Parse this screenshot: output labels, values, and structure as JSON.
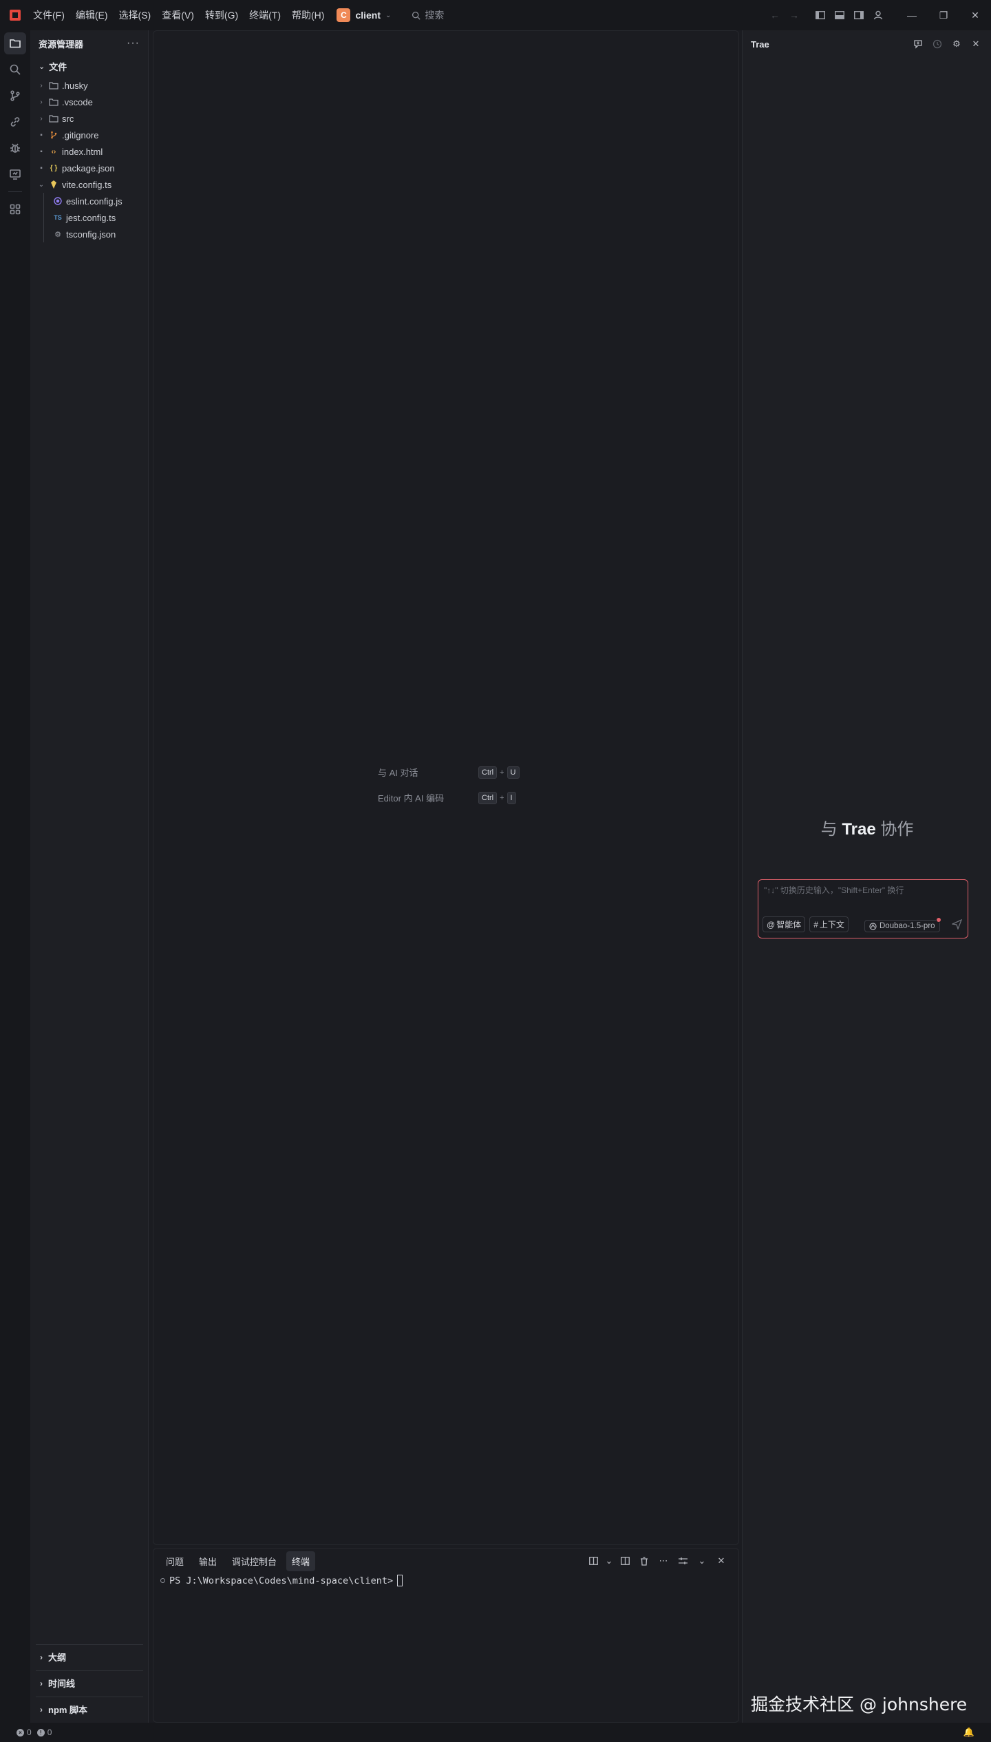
{
  "titlebar": {
    "menus": [
      "文件(F)",
      "编辑(E)",
      "选择(S)",
      "查看(V)",
      "转到(G)",
      "终端(T)",
      "帮助(H)"
    ],
    "project_badge": "C",
    "project_name": "client",
    "search_placeholder": "搜索"
  },
  "sidebar": {
    "title": "资源管理器",
    "more": "···",
    "files_header": "文件",
    "tree": [
      {
        "name": ".husky",
        "type": "folder"
      },
      {
        "name": ".vscode",
        "type": "folder"
      },
      {
        "name": "src",
        "type": "folder"
      },
      {
        "name": ".gitignore",
        "type": "git"
      },
      {
        "name": "index.html",
        "type": "html"
      },
      {
        "name": "package.json",
        "type": "json"
      },
      {
        "name": "vite.config.ts",
        "type": "vite"
      },
      {
        "name": "eslint.config.js",
        "type": "eslint"
      },
      {
        "name": "jest.config.ts",
        "type": "ts"
      },
      {
        "name": "tsconfig.json",
        "type": "tsconfig"
      }
    ],
    "sections": [
      "大纲",
      "时间线",
      "npm 脚本"
    ]
  },
  "editor": {
    "hints": [
      {
        "label": "与 AI 对话",
        "keys": [
          "Ctrl",
          "U"
        ]
      },
      {
        "label": "Editor 内 AI 编码",
        "keys": [
          "Ctrl",
          "I"
        ]
      }
    ]
  },
  "panel": {
    "tabs": [
      "问题",
      "输出",
      "调试控制台",
      "终端"
    ],
    "active_tab": "终端",
    "terminal_prompt": "PS J:\\Workspace\\Codes\\mind-space\\client>"
  },
  "ai": {
    "title": "Trae",
    "collab_prefix": "与",
    "collab_brand": "Trae",
    "collab_suffix": "协作",
    "input_placeholder": "\"↑↓\" 切换历史输入，\"Shift+Enter\" 换行",
    "agent_chip": "智能体",
    "context_chip": "上下文",
    "model": "Doubao-1.5-pro",
    "watermark": "掘金技术社区 @ johnshere"
  },
  "status": {
    "errors": "0",
    "warnings": "0"
  },
  "colors": {
    "accent": "#e0606a",
    "project_badge": "#f08a58",
    "logo": "#e5473d"
  }
}
